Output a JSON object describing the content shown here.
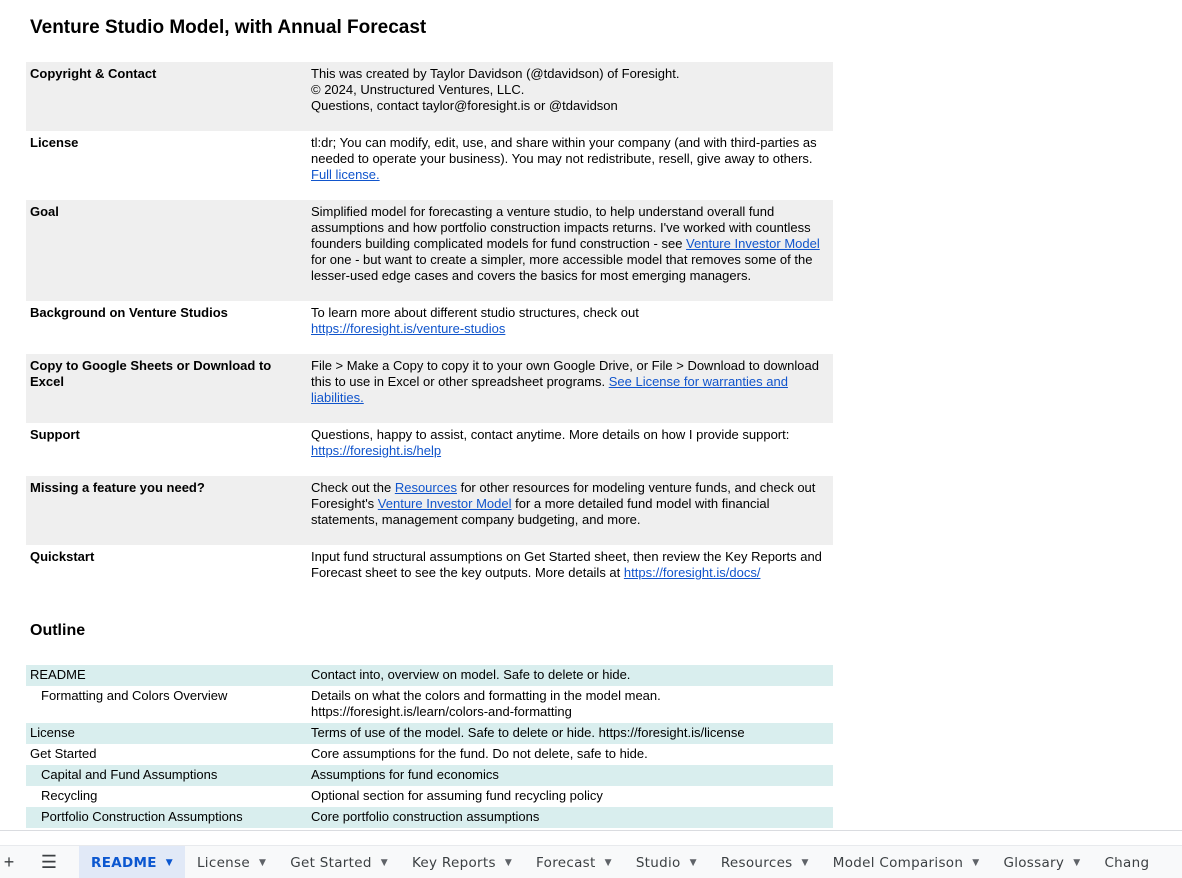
{
  "title": "Venture Studio Model, with Annual Forecast",
  "info": [
    {
      "label": "Copyright & Contact",
      "shade": true,
      "height": 69,
      "parts": [
        {
          "text": "This was created by Taylor Davidson (@tdavidson) of Foresight."
        },
        {
          "br": true
        },
        {
          "text": "© 2024, Unstructured Ventures, LLC."
        },
        {
          "br": true
        },
        {
          "text": "Questions, contact taylor@foresight.is or @tdavidson"
        }
      ]
    },
    {
      "label": "License",
      "shade": false,
      "height": 69,
      "parts": [
        {
          "text": "tl:dr; You can modify, edit, use, and share within your company (and with third-parties as needed to operate your business). You may not redistribute, resell, give away to others. "
        },
        {
          "link": "Full license."
        }
      ]
    },
    {
      "label": "Goal",
      "shade": true,
      "height": 101,
      "parts": [
        {
          "text": "Simplified model for forecasting a venture studio, to help understand overall fund assumptions and how portfolio construction impacts returns. I've worked with countless founders building complicated models for fund construction - see "
        },
        {
          "link": "Venture Investor Model"
        },
        {
          "text": " for one - but want to create a simpler, more accessible model that removes some of the lesser-used edge cases and covers the basics for most emerging managers."
        }
      ]
    },
    {
      "label": "Background on Venture Studios",
      "shade": false,
      "height": 53,
      "parts": [
        {
          "text": "To learn more about different studio structures, check out "
        },
        {
          "br": true
        },
        {
          "link": "https://foresight.is/venture-studios"
        }
      ]
    },
    {
      "label": "Copy to Google Sheets or Download to Excel",
      "shade": true,
      "height": 69,
      "parts": [
        {
          "text": "File > Make a Copy to copy it to your own Google Drive, or File > Download to download this to use in Excel or other spreadsheet programs. "
        },
        {
          "link": "See License for warranties and liabilities."
        }
      ]
    },
    {
      "label": "Support",
      "shade": false,
      "height": 53,
      "parts": [
        {
          "text": "Questions, happy to assist, contact anytime. More details on how I provide support: "
        },
        {
          "br": true
        },
        {
          "link": "https://foresight.is/help"
        }
      ]
    },
    {
      "label": "Missing a feature you need?",
      "shade": true,
      "height": 69,
      "parts": [
        {
          "text": "Check out the "
        },
        {
          "link": "Resources"
        },
        {
          "text": " for other resources for modeling venture funds, and check out Foresight's "
        },
        {
          "link": "Venture Investor Model"
        },
        {
          "text": " for a more detailed fund model with financial statements, management company budgeting, and more."
        }
      ]
    },
    {
      "label": "Quickstart",
      "shade": false,
      "height": 53,
      "parts": [
        {
          "text": "Input fund structural assumptions on Get Started sheet, then review the Key Reports and Forecast sheet to see the key outputs. More details at "
        },
        {
          "link": "https://foresight.is/docs/"
        }
      ]
    }
  ],
  "outline": {
    "title": "Outline",
    "rows": [
      {
        "label": "README",
        "indent": false,
        "teal": true,
        "desc": "Contact into, overview on model. Safe to delete or hide."
      },
      {
        "label": "Formatting and Colors Overview",
        "indent": true,
        "teal": false,
        "desc": "Details on what the colors and formatting in the model mean. https://foresight.is/learn/colors-and-formatting"
      },
      {
        "label": "License",
        "indent": false,
        "teal": true,
        "desc": "Terms of use of the model. Safe to delete or hide. https://foresight.is/license"
      },
      {
        "label": "Get Started",
        "indent": false,
        "teal": false,
        "desc": "Core assumptions for the fund. Do not delete, safe to hide."
      },
      {
        "label": "Capital and Fund Assumptions",
        "indent": true,
        "teal": true,
        "desc": "Assumptions for fund economics"
      },
      {
        "label": "Recycling",
        "indent": true,
        "teal": false,
        "desc": "Optional section for assuming fund recycling policy"
      },
      {
        "label": "Portfolio Construction Assumptions",
        "indent": true,
        "teal": true,
        "desc": "Core portfolio construction assumptions"
      }
    ]
  },
  "tabbar": {
    "add_icon": "+",
    "menu_icon": "☰",
    "tabs": [
      {
        "label": "README",
        "active": true
      },
      {
        "label": "License",
        "active": false
      },
      {
        "label": "Get Started",
        "active": false
      },
      {
        "label": "Key Reports",
        "active": false
      },
      {
        "label": "Forecast",
        "active": false
      },
      {
        "label": "Studio",
        "active": false
      },
      {
        "label": "Resources",
        "active": false
      },
      {
        "label": "Model Comparison",
        "active": false
      },
      {
        "label": "Glossary",
        "active": false
      },
      {
        "label": "Chang",
        "active": false
      }
    ]
  },
  "colors": {
    "link": "#1155cc",
    "shade_row": "#efefef",
    "teal_row": "#d9eeee",
    "active_tab_bg": "#e1e9f7",
    "active_tab_text": "#0b57d0"
  }
}
